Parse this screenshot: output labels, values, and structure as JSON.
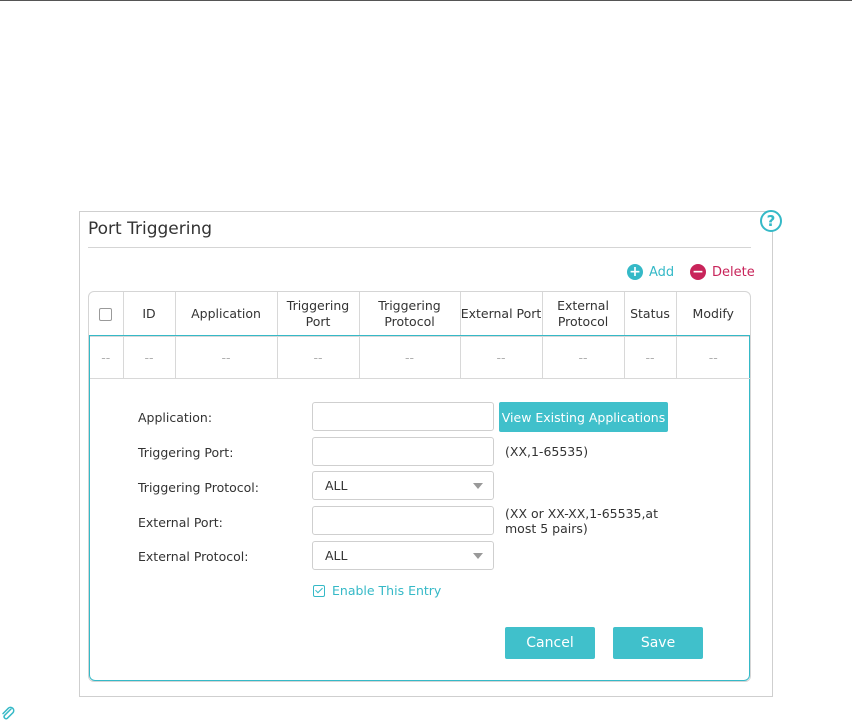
{
  "panel": {
    "title": "Port Triggering",
    "help_icon": "question-icon",
    "help_symbol": "?"
  },
  "actions": {
    "add_label": "Add",
    "delete_label": "Delete",
    "add_icon": "plus-circle-icon",
    "delete_icon": "minus-circle-icon"
  },
  "table": {
    "headers": [
      "ID",
      "Application",
      "Triggering Port",
      "Triggering Protocol",
      "External Port",
      "External Protocol",
      "Status",
      "Modify"
    ],
    "empty_row": [
      "--",
      "--",
      "--",
      "--",
      "--",
      "--",
      "--",
      "--",
      "--"
    ]
  },
  "form": {
    "application_label": "Application:",
    "application_value": "",
    "view_apps_button": "View Existing Applications",
    "triggering_port_label": "Triggering Port:",
    "triggering_port_value": "",
    "triggering_port_hint": "(XX,1-65535)",
    "triggering_protocol_label": "Triggering Protocol:",
    "triggering_protocol_value": "ALL",
    "external_port_label": "External Port:",
    "external_port_value": "",
    "external_port_hint": "(XX or XX-XX,1-65535,at most 5 pairs)",
    "external_protocol_label": "External Protocol:",
    "external_protocol_value": "ALL",
    "enable_label": "Enable This Entry",
    "enable_checked": true,
    "cancel_button": "Cancel",
    "save_button": "Save"
  },
  "colors": {
    "accent": "#40c0cb",
    "delete": "#c8245a"
  }
}
